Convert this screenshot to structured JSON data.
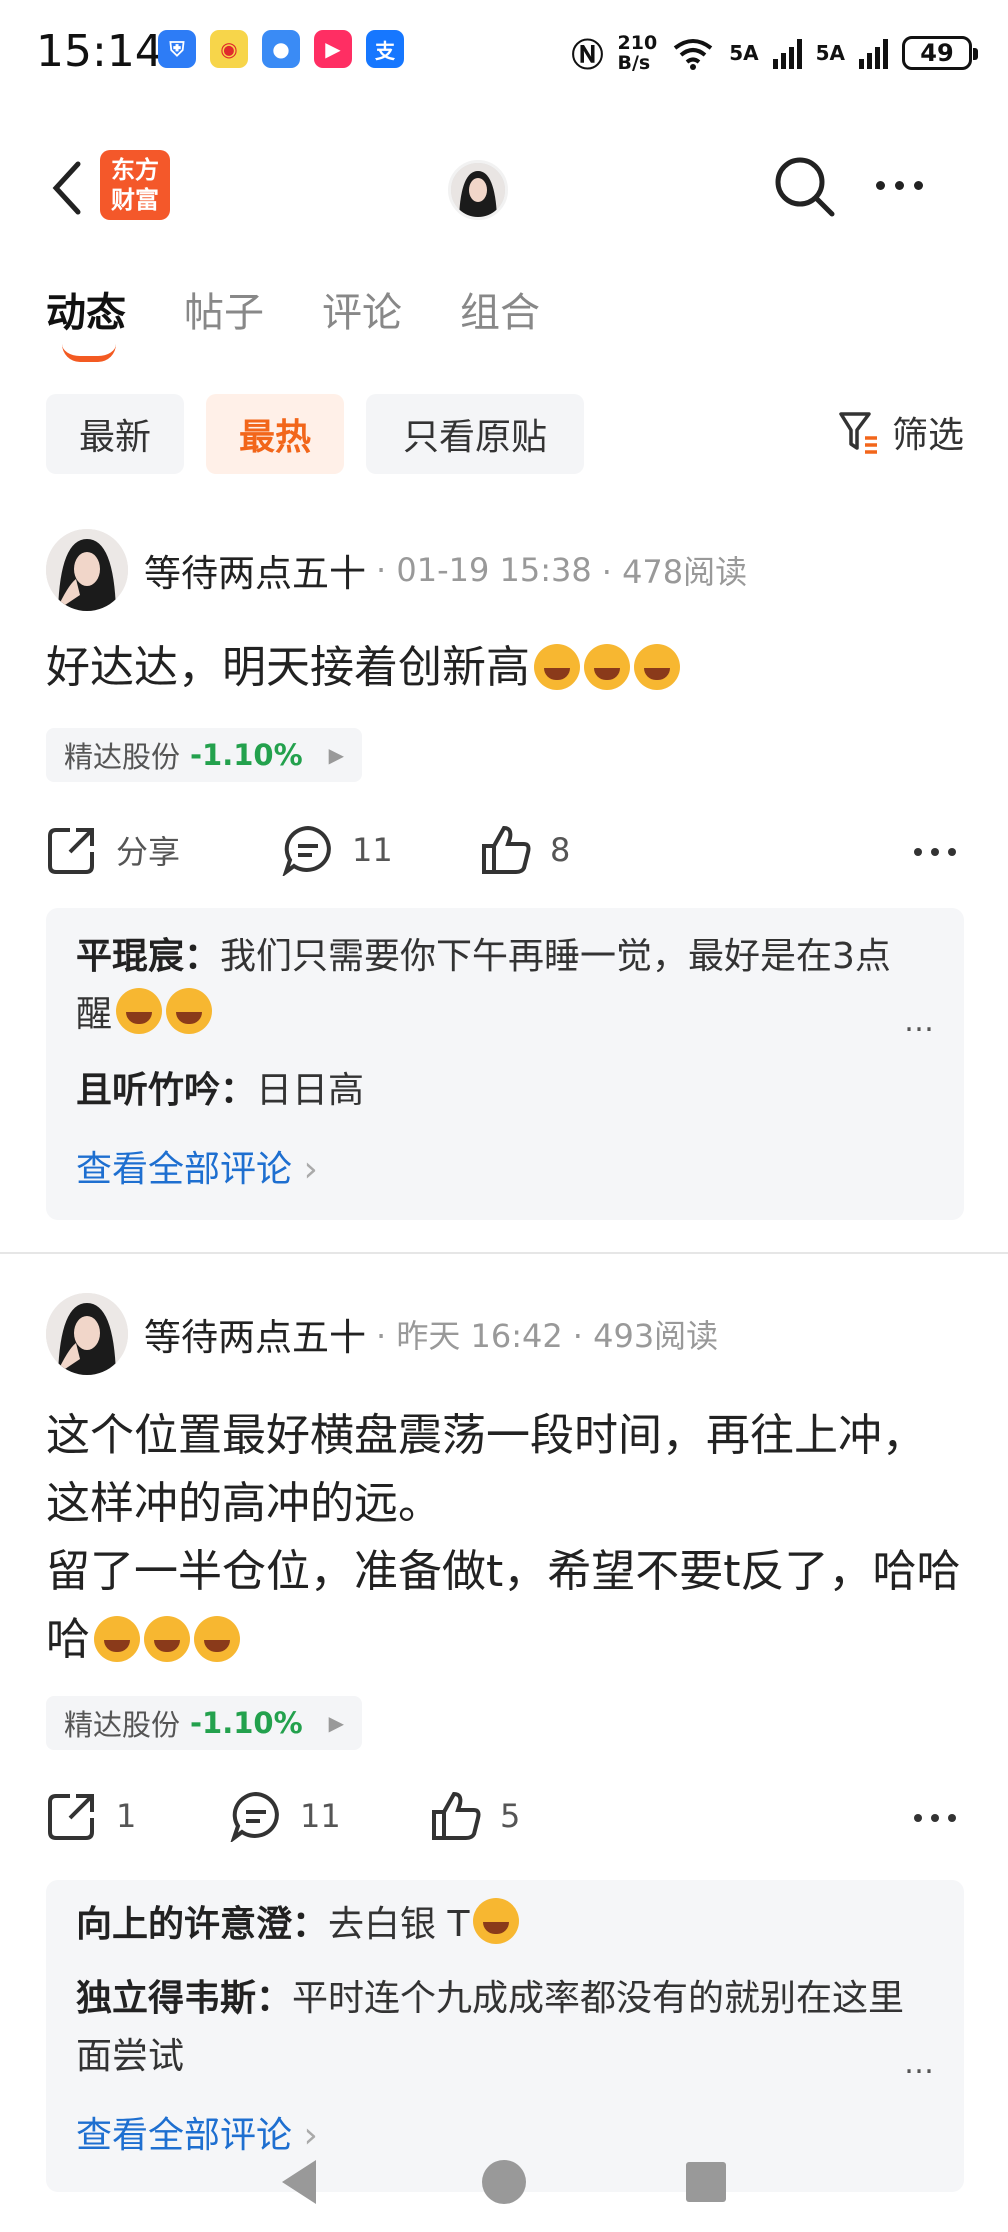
{
  "status_bar": {
    "time": "15:14",
    "net_speed_value": "210",
    "net_speed_unit": "B/s",
    "network_1": "5A",
    "network_2": "5A",
    "battery": "49",
    "apps": [
      {
        "icon": "shield-app-icon",
        "color": "#2d7cf6"
      },
      {
        "icon": "weibo-app-icon",
        "color": "#f7d54a"
      },
      {
        "icon": "message-app-icon",
        "color": "#3a8bf5"
      },
      {
        "icon": "video-app-icon",
        "color": "#ff2e63"
      },
      {
        "icon": "alipay-app-icon",
        "color": "#1677ff"
      }
    ],
    "alipay_glyph": "支"
  },
  "header": {
    "logo_line1": "东方",
    "logo_line2": "财富",
    "accent": "#f35a22"
  },
  "tabs": [
    {
      "label": "动态",
      "active": true
    },
    {
      "label": "帖子",
      "active": false
    },
    {
      "label": "评论",
      "active": false
    },
    {
      "label": "组合",
      "active": false
    }
  ],
  "filters": {
    "newest": "最新",
    "hottest": "最热",
    "original_only": "只看原贴",
    "filter_label": "筛选"
  },
  "posts": [
    {
      "author": "等待两点五十",
      "time": "· 01-19 15:38",
      "reads": "· 478阅读",
      "text": "好达达，明天接着创新高",
      "emoji_count": 3,
      "stock_name": "精达股份",
      "stock_change": "-1.10%",
      "share_label": "分享",
      "comment_count": "11",
      "like_count": "8",
      "comments": [
        {
          "user": "平琨宸：",
          "text": "我们只需要你下午再睡一觉，最好是在3点醒"
        },
        {
          "user": "且听竹吟：",
          "text": "日日高"
        }
      ],
      "see_all": "查看全部评论"
    },
    {
      "author": "等待两点五十",
      "time": "· 昨天 16:42",
      "reads": "· 493阅读",
      "text": "这个位置最好横盘震荡一段时间，再往上冲，这样冲的高冲的远。",
      "text2": "留了一半仓位，准备做t，希望不要t反了，哈哈哈",
      "stock_name": "精达股份",
      "stock_change": "-1.10%",
      "share_count": "1",
      "comment_count": "11",
      "like_count": "5",
      "comments": [
        {
          "user": "向上的许意澄：",
          "text": "去白银 T"
        },
        {
          "user": "独立得韦斯：",
          "text": "平时连个九成成率都没有的就别在这里面尝试"
        }
      ],
      "see_all": "查看全部评论"
    }
  ]
}
